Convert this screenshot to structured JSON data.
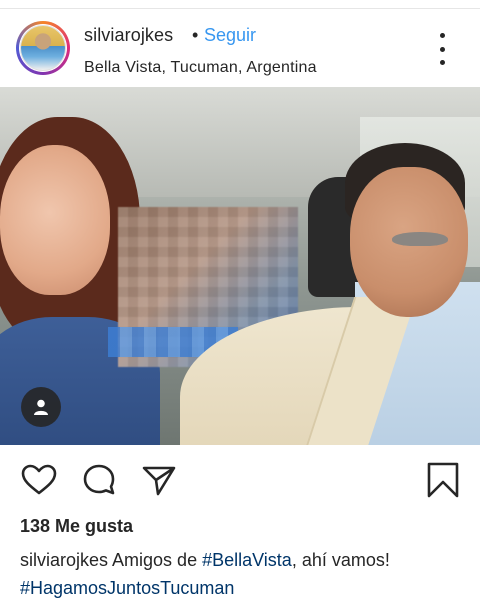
{
  "header": {
    "username": "silviarojkes",
    "separator": "•",
    "follow_label": "Seguir",
    "location": "Bella Vista, Tucuman, Argentina",
    "more_icon": "more-vertical-icon"
  },
  "photo": {
    "tag_icon": "user-tag-icon"
  },
  "actions": {
    "like_icon": "heart-icon",
    "comment_icon": "comment-icon",
    "share_icon": "send-icon",
    "save_icon": "bookmark-icon"
  },
  "post": {
    "likes_text": "138 Me gusta",
    "caption_user": "silviarojkes",
    "caption_text": " Amigos de ",
    "hashtag_1": "#BellaVista",
    "caption_text_2": ", ahí vamos!",
    "hashtag_2": "#HagamosJuntosTucuman"
  },
  "colors": {
    "link_blue": "#3897f0",
    "hashtag_blue": "#003569",
    "text": "#262626"
  }
}
